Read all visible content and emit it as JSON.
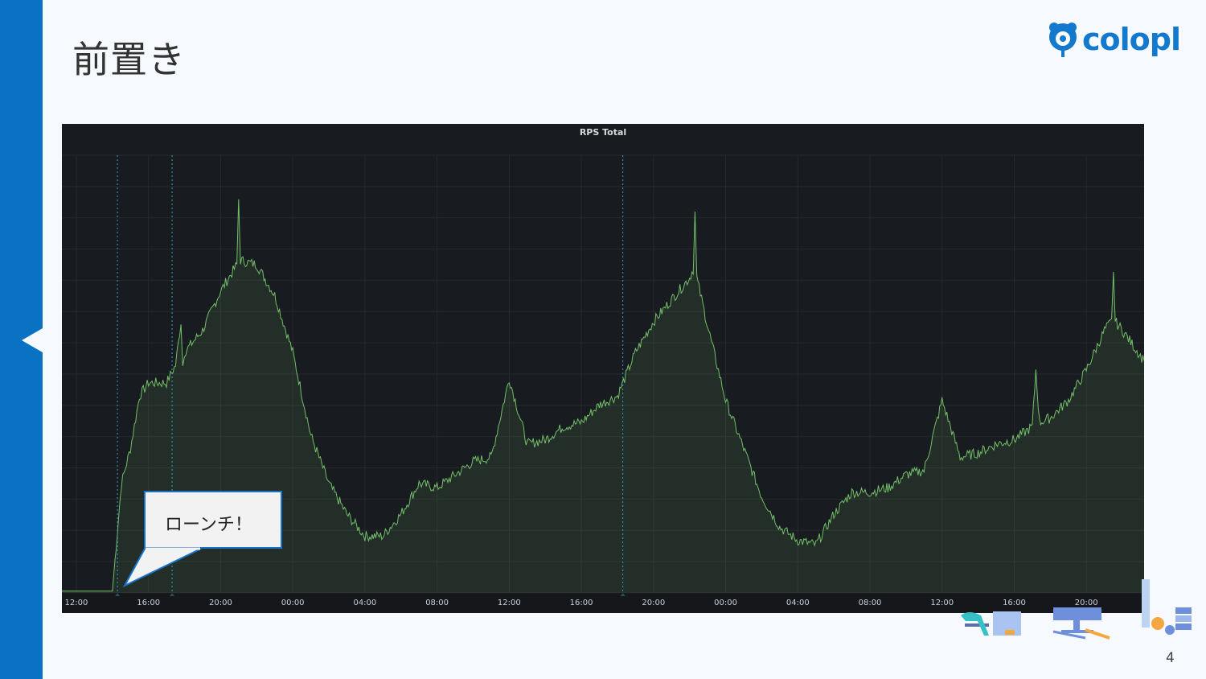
{
  "slide": {
    "title": "前置き",
    "page_number": "4",
    "logo_text": "colopl",
    "accent": "#0a72c3"
  },
  "callout": {
    "text": "ローンチ！"
  },
  "chart_data": {
    "type": "area",
    "title": "RPS Total",
    "xlabel": "",
    "ylabel": "",
    "x_unit": "hours since first 12:00 tick",
    "y_unit": "relative RPS (percent of panel height, unlabeled axis)",
    "xlim": [
      -0.8,
      59.2
    ],
    "ylim": [
      0,
      100
    ],
    "grid": true,
    "line_color": "#73bf69",
    "x_ticks": [
      {
        "h": 0,
        "label": "12:00"
      },
      {
        "h": 4,
        "label": "16:00"
      },
      {
        "h": 8,
        "label": "20:00"
      },
      {
        "h": 12,
        "label": "00:00"
      },
      {
        "h": 16,
        "label": "04:00"
      },
      {
        "h": 20,
        "label": "08:00"
      },
      {
        "h": 24,
        "label": "12:00"
      },
      {
        "h": 28,
        "label": "16:00"
      },
      {
        "h": 32,
        "label": "20:00"
      },
      {
        "h": 36,
        "label": "00:00"
      },
      {
        "h": 40,
        "label": "04:00"
      },
      {
        "h": 44,
        "label": "08:00"
      },
      {
        "h": 48,
        "label": "12:00"
      },
      {
        "h": 52,
        "label": "16:00"
      },
      {
        "h": 56,
        "label": "20:00"
      }
    ],
    "annotations_h": [
      2.28,
      5.31,
      30.3
    ],
    "x": [
      -0.8,
      2,
      2.5,
      3,
      3.5,
      4,
      5,
      5.5,
      5.8,
      5.9,
      6,
      7,
      8,
      8.9,
      9,
      9.1,
      10,
      11,
      12,
      13,
      14,
      15,
      16,
      17,
      18,
      19,
      20,
      21,
      22,
      23,
      24,
      25,
      26,
      27,
      28,
      29,
      30,
      31,
      32,
      33,
      34,
      34.2,
      34.3,
      34.4,
      35,
      36,
      37,
      38,
      39,
      40,
      41,
      42,
      43,
      44,
      45,
      46,
      47,
      48,
      49,
      50,
      51,
      52,
      53,
      53.2,
      53.4,
      54,
      55,
      56,
      57,
      57.4,
      57.5,
      57.6,
      58,
      59.2
    ],
    "y": [
      0.4,
      0.4,
      25,
      33,
      45,
      48,
      48,
      52,
      62,
      52,
      55,
      60,
      69,
      75,
      90,
      76,
      75,
      68,
      55,
      36,
      25,
      18,
      13,
      13,
      18,
      25,
      24,
      27,
      30,
      31,
      49,
      34,
      35,
      38,
      39,
      43,
      45,
      55,
      62,
      67,
      72,
      74,
      87,
      72,
      61,
      44,
      33,
      22,
      15,
      12,
      11,
      18,
      23,
      23,
      24,
      27,
      28,
      44,
      31,
      32,
      34,
      35,
      38,
      51,
      39,
      40,
      44,
      51,
      60,
      62,
      74,
      62,
      60,
      53
    ]
  }
}
